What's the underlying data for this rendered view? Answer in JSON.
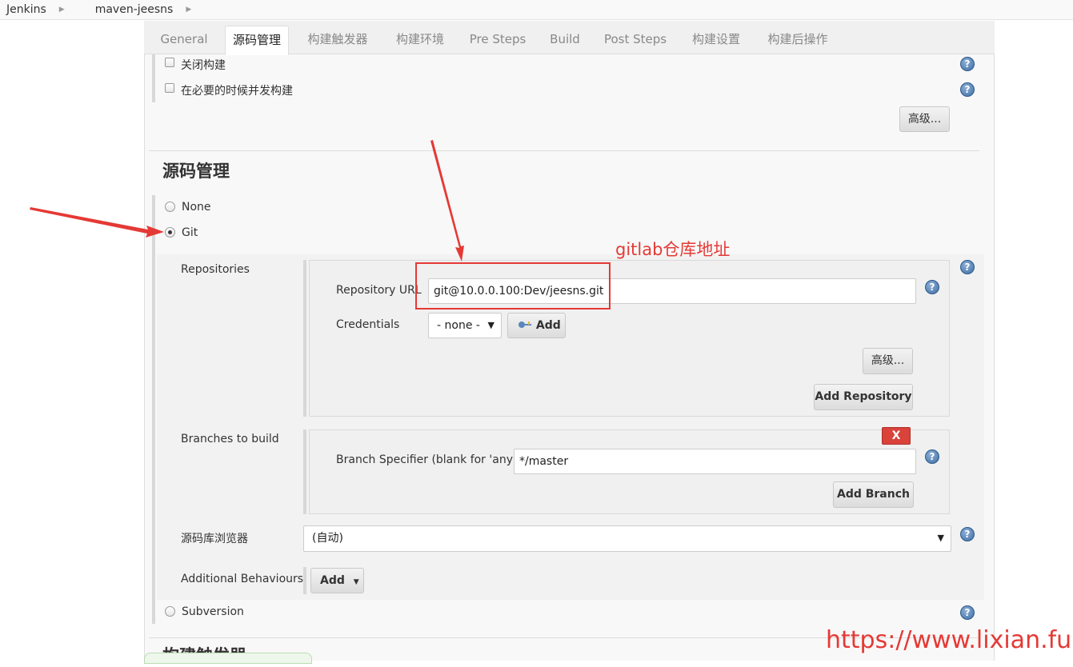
{
  "breadcrumb": {
    "items": [
      "Jenkins",
      "maven-jeesns"
    ]
  },
  "tabs": [
    "General",
    "源码管理",
    "构建触发器",
    "构建环境",
    "Pre Steps",
    "Build",
    "Post Steps",
    "构建设置",
    "构建后操作"
  ],
  "general": {
    "disable_build": "关闭构建",
    "concurrent_build": "在必要的时候并发构建",
    "advanced": "高级..."
  },
  "scm": {
    "title": "源码管理",
    "options": {
      "none": "None",
      "git": "Git",
      "subversion": "Subversion"
    },
    "repositories_label": "Repositories",
    "repo_url_label": "Repository URL",
    "repo_url_value": "git@10.0.0.100:Dev/jeesns.git",
    "credentials_label": "Credentials",
    "credentials_value": "- none -",
    "add_label": "Add",
    "advanced": "高级...",
    "add_repository": "Add Repository",
    "branches_label": "Branches to build",
    "remove_label": "X",
    "branch_spec_label": "Branch Specifier (blank for 'any')",
    "branch_spec_value": "*/master",
    "add_branch": "Add Branch",
    "browser_label": "源码库浏览器",
    "browser_value": "(自动)",
    "behaviours_label": "Additional Behaviours",
    "behaviours_add": "Add"
  },
  "next_section_title": "构建触发器",
  "annotation": "gitlab仓库地址",
  "watermark": "https://www.lixian.fun",
  "colors": {
    "annotation": "#e53935",
    "help": "#3c6ea5",
    "danger": "#d9433a"
  },
  "icons": [
    "help-icon",
    "credentials-key-icon",
    "dropdown-caret-icon",
    "breadcrumb-arrow-icon"
  ]
}
